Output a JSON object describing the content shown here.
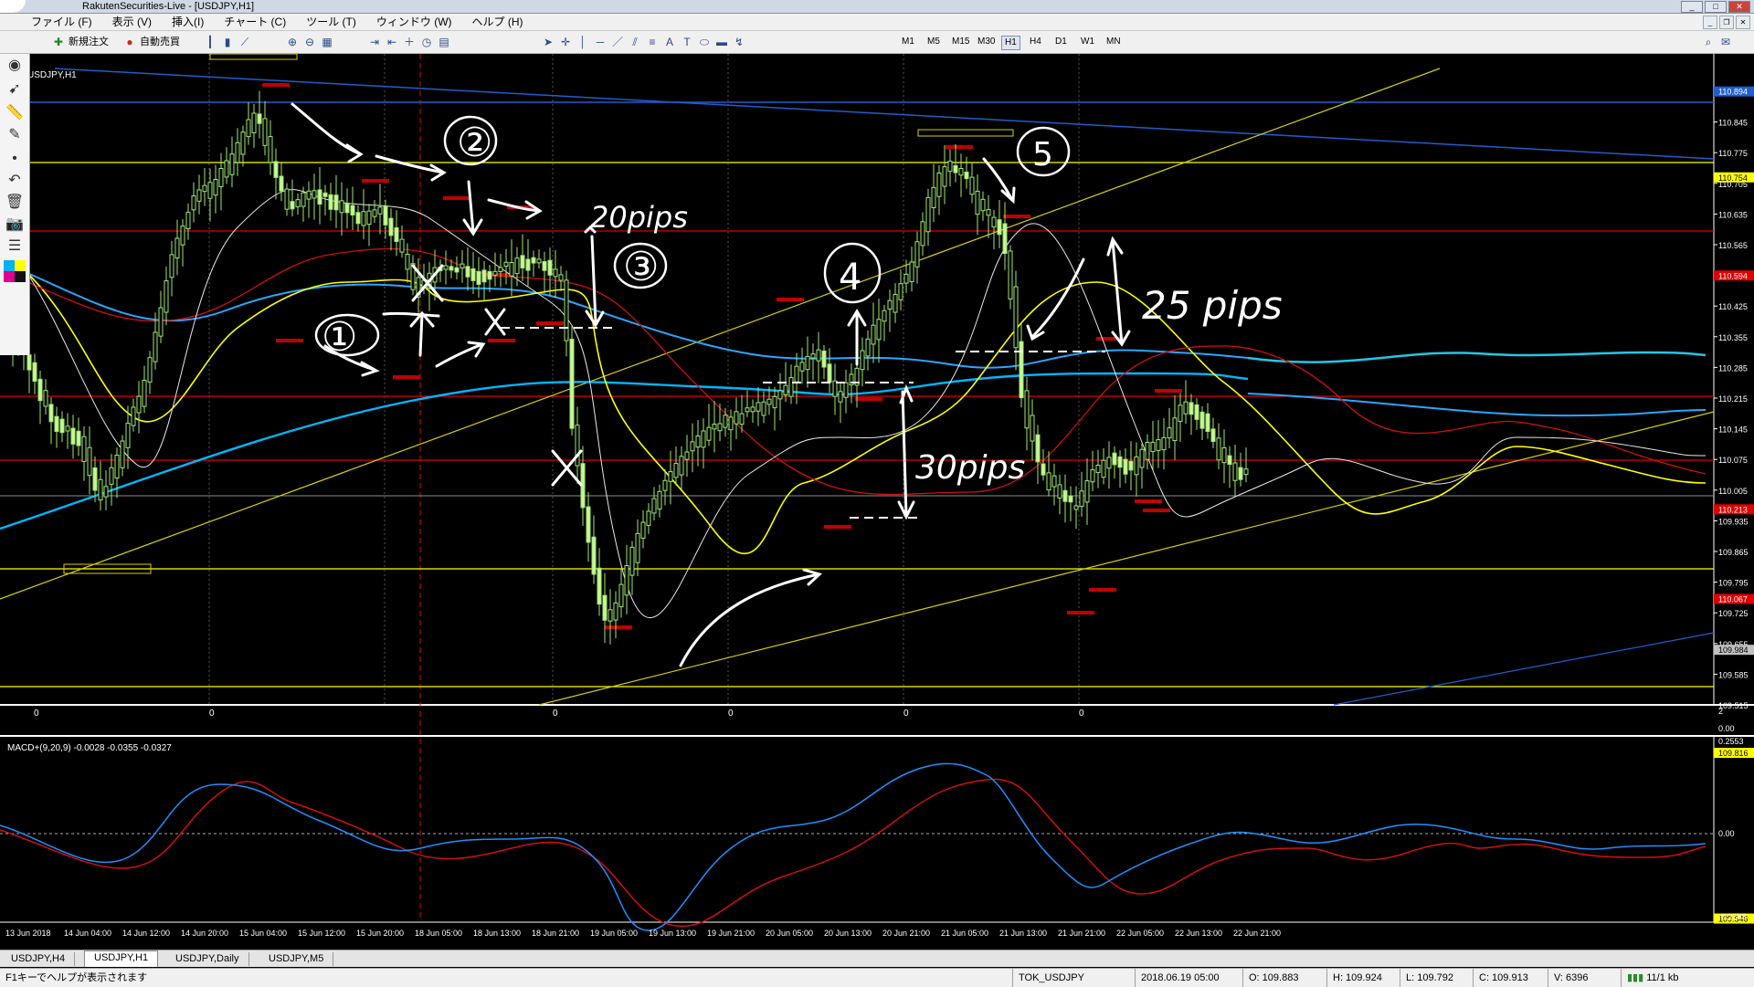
{
  "window": {
    "title": "RakutenSecurities-Live - [USDJPY,H1]",
    "min": "_",
    "max": "□",
    "close": "✕"
  },
  "menu": [
    "ファイル (F)",
    "表示 (V)",
    "挿入(I)",
    "チャート (C)",
    "ツール (T)",
    "ウィンドウ (W)",
    "ヘルプ (H)"
  ],
  "toolbar": {
    "new_order": "新規注文",
    "auto_trade": "自動売買"
  },
  "timeframes": [
    "M1",
    "M5",
    "M15",
    "M30",
    "H1",
    "H4",
    "D1",
    "W1",
    "MN"
  ],
  "active_timeframe": "H1",
  "chart": {
    "symbol_label": "USDJPY,H1",
    "price_labels": [
      "110.895",
      "110.845",
      "110.775",
      "110.705",
      "110.635",
      "110.565",
      "110.495",
      "110.425",
      "110.355",
      "110.285",
      "110.215",
      "110.145",
      "110.075",
      "110.005",
      "109.935",
      "109.865",
      "109.795",
      "109.725",
      "109.655",
      "109.585",
      "109.515"
    ],
    "marked_levels": [
      {
        "value": "110.894",
        "color": "#1e5ecf"
      },
      {
        "value": "110.754",
        "color": "#ffff00"
      },
      {
        "value": "110.594",
        "color": "#e00000"
      },
      {
        "value": "110.213",
        "color": "#e00000"
      },
      {
        "value": "110.067",
        "color": "#e00000"
      },
      {
        "value": "109.984",
        "color": "#c0c0c0"
      },
      {
        "value": "109.816",
        "color": "#ffff00"
      },
      {
        "value": "109.546",
        "color": "#ffff00"
      }
    ],
    "sub_zero_labels": [
      "0",
      "0",
      "0",
      "0",
      "0",
      "0"
    ],
    "sub_right_labels": [
      "2",
      "0.00"
    ],
    "macd_label": "MACD+(9,20,9) -0.0028 -0.0355 -0.0327",
    "macd_scale": [
      "0.2553",
      "0.00",
      "-0.2553"
    ],
    "time_labels": [
      "13 Jun 2018",
      "14 Jun 04:00",
      "14 Jun 12:00",
      "14 Jun 20:00",
      "15 Jun 04:00",
      "15 Jun 12:00",
      "15 Jun 20:00",
      "18 Jun 05:00",
      "18 Jun 13:00",
      "18 Jun 21:00",
      "19 Jun 05:00",
      "19 Jun 13:00",
      "19 Jun 21:00",
      "20 Jun 05:00",
      "20 Jun 13:00",
      "20 Jun 21:00",
      "21 Jun 05:00",
      "21 Jun 13:00",
      "21 Jun 21:00",
      "22 Jun 05:00",
      "22 Jun 13:00",
      "22 Jun 21:00"
    ],
    "annotations": {
      "pips1": "20pips",
      "pips2": "25 pips",
      "pips3": "30pips",
      "n1": "①",
      "n2": "②",
      "n3": "③",
      "n4": "4",
      "n5": "5"
    }
  },
  "tabs": [
    "USDJPY,H4",
    "USDJPY,H1",
    "USDJPY,Daily",
    "USDJPY,M5"
  ],
  "active_tab": "USDJPY,H1",
  "status": {
    "help": "F1キーでヘルプが表示されます",
    "profile": "TOK_USDJPY",
    "datetime": "2018.06.19 05:00",
    "open": "O: 109.883",
    "high": "H: 109.924",
    "low": "L: 109.792",
    "close": "C: 109.913",
    "volume": "V: 6396",
    "traffic": "11/1 kb"
  }
}
